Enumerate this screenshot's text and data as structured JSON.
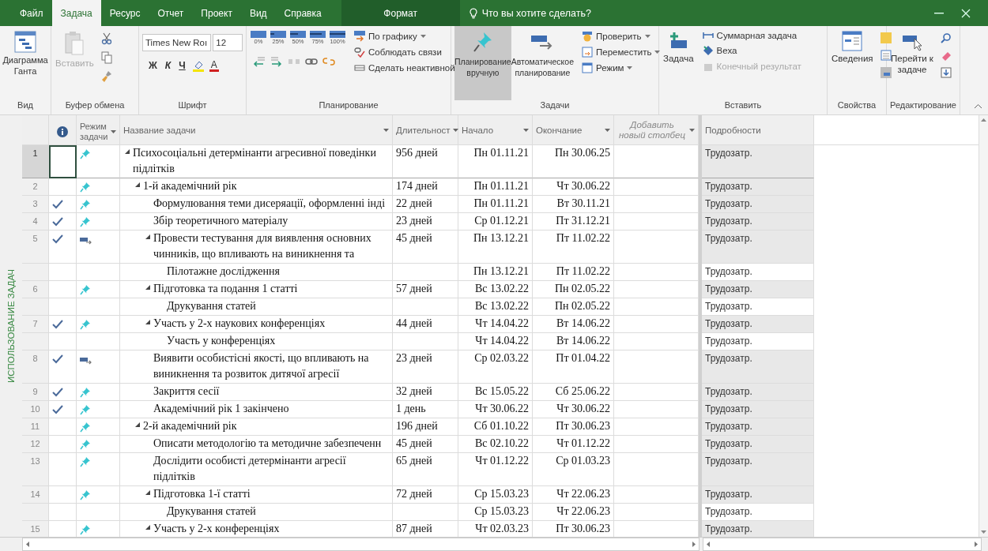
{
  "tabs": [
    {
      "label": "Файл",
      "selected": false,
      "kind": "normal"
    },
    {
      "label": "Задача",
      "selected": true,
      "kind": "normal"
    },
    {
      "label": "Ресурс",
      "selected": false,
      "kind": "normal"
    },
    {
      "label": "Отчет",
      "selected": false,
      "kind": "normal"
    },
    {
      "label": "Проект",
      "selected": false,
      "kind": "normal"
    },
    {
      "label": "Вид",
      "selected": false,
      "kind": "normal"
    },
    {
      "label": "Справка",
      "selected": false,
      "kind": "normal"
    },
    {
      "label": "Формат",
      "selected": false,
      "kind": "context"
    }
  ],
  "tell_me": "Что вы хотите сделать?",
  "ribbon": {
    "view": {
      "label": "Вид",
      "gantt": "Диаграмма Ганта"
    },
    "clipboard": {
      "label": "Буфер обмена",
      "paste": {
        "text": "Вставить",
        "disabled": true
      }
    },
    "font": {
      "label": "Шрифт",
      "family": "Times New Roı",
      "size": "12",
      "bold": "Ж",
      "italic": "К",
      "underline": "Ч",
      "color_letter": "А"
    },
    "schedule": {
      "label": "Планирование",
      "percents": [
        "0%",
        "25%",
        "50%",
        "75%",
        "100%"
      ],
      "commands": [
        "По графику",
        "Соблюдать связи",
        "Сделать неактивной"
      ]
    },
    "tasks": {
      "label": "Задачи",
      "modes": [
        {
          "text": "Планирование вручную",
          "selected": true
        },
        {
          "text": "Автоматическое планирование",
          "selected": false
        }
      ],
      "commands": [
        "Проверить",
        "Переместить",
        "Режим"
      ]
    },
    "insert": {
      "label": "Вставить",
      "task": "Задача",
      "commands": [
        {
          "text": "Суммарная задача",
          "disabled": false
        },
        {
          "text": "Веха",
          "disabled": false
        },
        {
          "text": "Конечный результат",
          "disabled": true
        }
      ]
    },
    "properties": {
      "label": "Свойства",
      "info": "Сведения"
    },
    "editing": {
      "label": "Редактирование",
      "goto": "Перейти к задаче"
    }
  },
  "view_label": "ИСПОЛЬЗОВАНИЕ ЗАДАЧ",
  "table": {
    "columns": {
      "mode": "Режим задачи",
      "name": "Название задачи",
      "duration": "Длительност",
      "start": "Начало",
      "finish": "Окончание",
      "add": "Добавить новый столбец",
      "details": "Подробности"
    },
    "rows": [
      {
        "id": "1",
        "kind": "task",
        "expanded": true,
        "selected": true,
        "done": false,
        "manual": true,
        "name": "Психосоціальні детермінанти агресивної поведінки\nпідлітків",
        "duration": "956 дней",
        "start": "Пн 01.11.21",
        "finish": "Пн 30.06.25",
        "detail": "Трудозатр.",
        "children": [
          {
            "id": "2",
            "kind": "task",
            "expanded": true,
            "selected": false,
            "done": false,
            "manual": true,
            "name": "1-й академічний рік",
            "duration": "174 дней",
            "start": "Пн 01.11.21",
            "finish": "Чт 30.06.22",
            "detail": "Трудозатр.",
            "children": [
              {
                "id": "3",
                "kind": "task",
                "selected": false,
                "done": true,
                "manual": true,
                "name": "Формулювання теми дисеряації, оформленні інді",
                "duration": "22 дней",
                "start": "Пн 01.11.21",
                "finish": "Вт 30.11.21",
                "detail": "Трудозатр."
              },
              {
                "id": "4",
                "kind": "task",
                "selected": false,
                "done": true,
                "manual": true,
                "name": "Збір теоретичного матеріалу",
                "duration": "23 дней",
                "start": "Ср 01.12.21",
                "finish": "Пт 31.12.21",
                "detail": "Трудозатр."
              },
              {
                "id": "5",
                "kind": "task",
                "expanded": true,
                "selected": false,
                "done": true,
                "manual": false,
                "name": "Провести тестування для виявлення основних\nчинників, що впливають на виникнення та",
                "duration": "45 дней",
                "start": "Пн 13.12.21",
                "finish": "Пт 11.02.22",
                "detail": "Трудозатр.",
                "children": [
                  {
                    "kind": "assignment",
                    "selected": false,
                    "name": "Пілотажне дослідження",
                    "start": "Пн 13.12.21",
                    "finish": "Пт 11.02.22",
                    "detail": "Трудозатр."
                  }
                ]
              },
              {
                "id": "6",
                "kind": "task",
                "expanded": true,
                "selected": false,
                "done": false,
                "manual": true,
                "name": "Підготовка та подання 1 статті",
                "duration": "57 дней",
                "start": "Вс 13.02.22",
                "finish": "Пн 02.05.22",
                "detail": "Трудозатр.",
                "children": [
                  {
                    "kind": "assignment",
                    "selected": false,
                    "name": "Друкування статей",
                    "start": "Вс 13.02.22",
                    "finish": "Пн 02.05.22",
                    "detail": "Трудозатр."
                  }
                ]
              },
              {
                "id": "7",
                "kind": "task",
                "expanded": true,
                "selected": false,
                "done": true,
                "manual": true,
                "name": "Участь у 2-х наукових конференціях",
                "duration": "44 дней",
                "start": "Чт 14.04.22",
                "finish": "Вт 14.06.22",
                "detail": "Трудозатр.",
                "children": [
                  {
                    "kind": "assignment",
                    "selected": false,
                    "name": "Участь у конференціях",
                    "start": "Чт 14.04.22",
                    "finish": "Вт 14.06.22",
                    "detail": "Трудозатр."
                  }
                ]
              },
              {
                "id": "8",
                "kind": "task",
                "selected": false,
                "done": true,
                "manual": false,
                "name": "Виявити особистісні якості, що впливають на\nвиникнення та розвиток дитячої агресії",
                "duration": "23 дней",
                "start": "Ср 02.03.22",
                "finish": "Пт 01.04.22",
                "detail": "Трудозатр."
              },
              {
                "id": "9",
                "kind": "task",
                "selected": false,
                "done": true,
                "manual": true,
                "name": "Закриття сесії",
                "duration": "32 дней",
                "start": "Вс 15.05.22",
                "finish": "Сб 25.06.22",
                "detail": "Трудозатр."
              },
              {
                "id": "10",
                "kind": "task",
                "selected": false,
                "done": true,
                "manual": true,
                "name": "Академічний рік 1 закінчено",
                "duration": "1 день",
                "start": "Чт 30.06.22",
                "finish": "Чт 30.06.22",
                "detail": "Трудозатр."
              }
            ]
          },
          {
            "id": "11",
            "kind": "task",
            "expanded": true,
            "selected": false,
            "done": false,
            "manual": true,
            "name": "2-й академічний рік",
            "duration": "196 дней",
            "start": "Сб 01.10.22",
            "finish": "Пт 30.06.23",
            "detail": "Трудозатр.",
            "children": [
              {
                "id": "12",
                "kind": "task",
                "selected": false,
                "done": false,
                "manual": true,
                "name": "Описати методологію та методичне забезпеченн",
                "duration": "45 дней",
                "start": "Вс 02.10.22",
                "finish": "Чт 01.12.22",
                "detail": "Трудозатр."
              },
              {
                "id": "13",
                "kind": "task",
                "selected": false,
                "done": false,
                "manual": true,
                "name": "Дослідити особисті детермінанти агресії\nпідлітків",
                "duration": "65 дней",
                "start": "Чт 01.12.22",
                "finish": "Ср 01.03.23",
                "detail": "Трудозатр."
              },
              {
                "id": "14",
                "kind": "task",
                "expanded": true,
                "selected": false,
                "done": false,
                "manual": true,
                "name": "Підготовка 1-ї статті",
                "duration": "72 дней",
                "start": "Ср 15.03.23",
                "finish": "Чт 22.06.23",
                "detail": "Трудозатр.",
                "children": [
                  {
                    "kind": "assignment",
                    "selected": false,
                    "name": "Друкування статей",
                    "start": "Ср 15.03.23",
                    "finish": "Чт 22.06.23",
                    "detail": "Трудозатр."
                  }
                ]
              },
              {
                "id": "15",
                "kind": "task",
                "expanded": true,
                "selected": false,
                "done": false,
                "manual": true,
                "name": "Участь у 2-х конференціях",
                "duration": "87 дней",
                "start": "Чт 02.03.23",
                "finish": "Пт 30.06.23",
                "detail": "Трудозатр."
              }
            ]
          }
        ]
      }
    ]
  }
}
